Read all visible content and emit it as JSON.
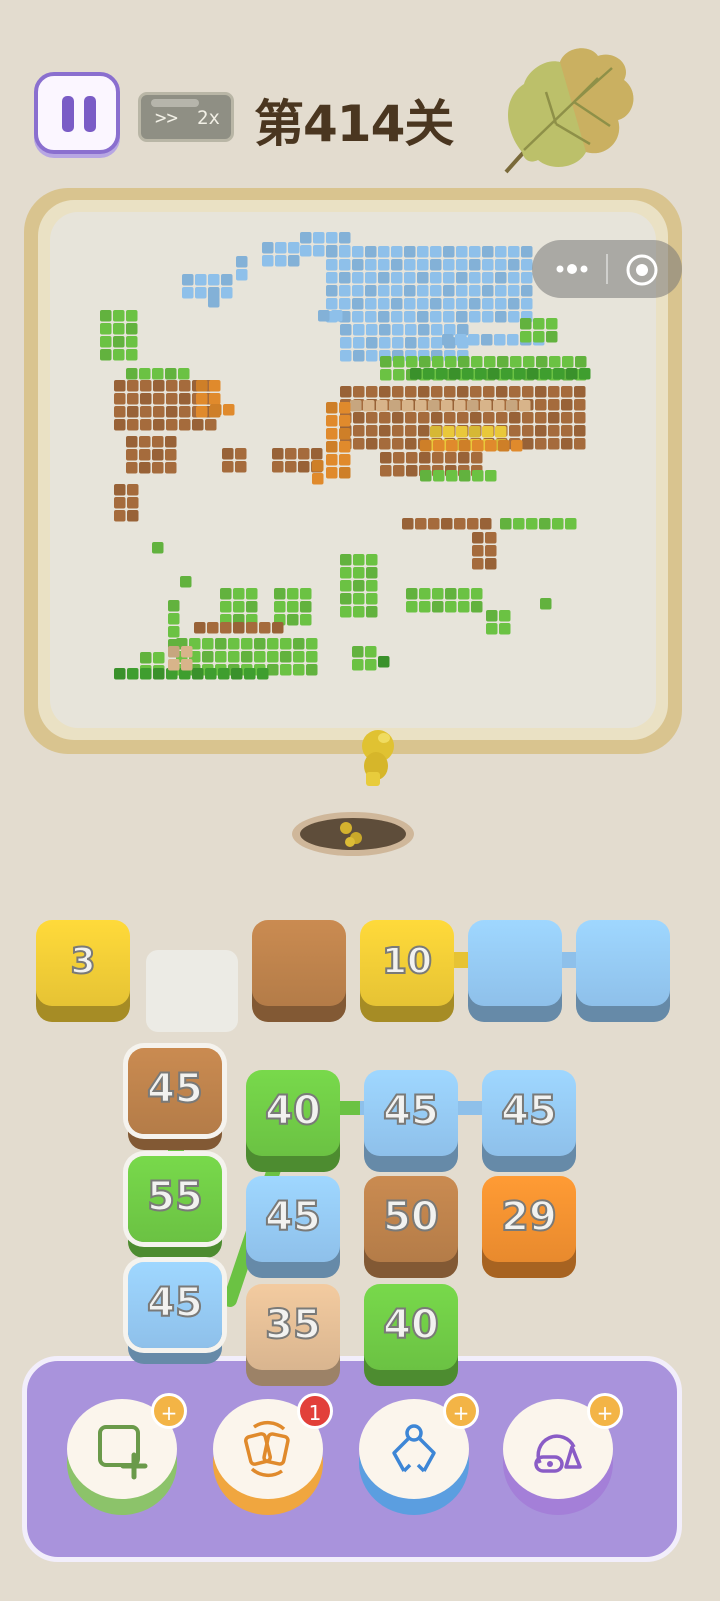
{
  "header": {
    "speed_arrows": ">>",
    "speed_multiplier": "2x",
    "level_title": "第414关"
  },
  "icons": {
    "pause": "pause-icon",
    "leaf": "leaf-icon",
    "more": "more-dots-icon",
    "close": "target-close-icon"
  },
  "queue_row": [
    {
      "color": "yellow",
      "number": "3"
    },
    {
      "color": "empty",
      "number": ""
    },
    {
      "color": "brown",
      "number": ""
    },
    {
      "color": "yellow",
      "number": "10"
    },
    {
      "color": "blue",
      "number": ""
    },
    {
      "color": "blue",
      "number": ""
    }
  ],
  "grid": [
    {
      "color": "brown",
      "number": "45",
      "selected": true
    },
    {
      "color": "green",
      "number": "40"
    },
    {
      "color": "blue",
      "number": "45"
    },
    {
      "color": "blue",
      "number": "45"
    },
    {
      "color": "green",
      "number": "55",
      "selected": true
    },
    {
      "color": "blue",
      "number": "45"
    },
    {
      "color": "brown",
      "number": "50"
    },
    {
      "color": "orange",
      "number": "29"
    },
    {
      "color": "blue",
      "number": "45",
      "selected": true
    },
    {
      "color": "tan",
      "number": "35"
    },
    {
      "color": "green",
      "number": "40"
    }
  ],
  "powerups": [
    {
      "name": "add-slot",
      "icon": "add-square-icon",
      "badge": "+",
      "base_color": "#8cc36a"
    },
    {
      "name": "shuffle",
      "icon": "shuffle-cards-icon",
      "badge": "1",
      "base_color": "#f0a63f"
    },
    {
      "name": "claw",
      "icon": "claw-icon",
      "badge": "+",
      "base_color": "#5b9ee0"
    },
    {
      "name": "vacuum",
      "icon": "vacuum-icon",
      "badge": "+",
      "base_color": "#a47fd8"
    }
  ],
  "colors": {
    "yellow": "#e6c334",
    "brown": "#b47c48",
    "blue": "#8ec0ea",
    "green": "#6bc243",
    "orange": "#e88a2e",
    "tan": "#d9b58f",
    "accent": "#a993dc"
  }
}
